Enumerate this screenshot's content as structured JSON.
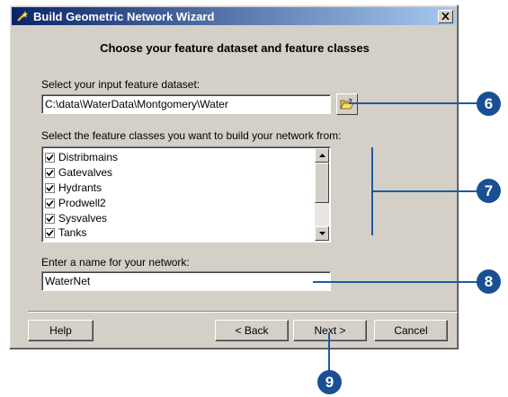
{
  "window": {
    "title": "Build Geometric Network Wizard",
    "close_label": "✕"
  },
  "heading": "Choose your feature dataset and feature classes",
  "dataset": {
    "label": "Select your input feature dataset:",
    "value": "C:\\data\\WaterData\\Montgomery\\Water",
    "browse_icon": "open-folder-icon"
  },
  "classes": {
    "label": "Select the feature classes you want to build your network from:",
    "items": [
      {
        "label": "Distribmains",
        "checked": true
      },
      {
        "label": "Gatevalves",
        "checked": true
      },
      {
        "label": "Hydrants",
        "checked": true
      },
      {
        "label": "Prodwell2",
        "checked": true
      },
      {
        "label": "Sysvalves",
        "checked": true
      },
      {
        "label": "Tanks",
        "checked": true
      }
    ]
  },
  "network_name": {
    "label": "Enter a name for your network:",
    "value": "WaterNet"
  },
  "buttons": {
    "help": "Help",
    "back": "< Back",
    "next": "Next >",
    "cancel": "Cancel"
  },
  "callouts": [
    "6",
    "7",
    "8",
    "9"
  ],
  "colors": {
    "titlebar_start": "#0a246a",
    "titlebar_end": "#a6caf0",
    "dialog_bg": "#d4d0c8",
    "callout": "#1a4f93"
  }
}
